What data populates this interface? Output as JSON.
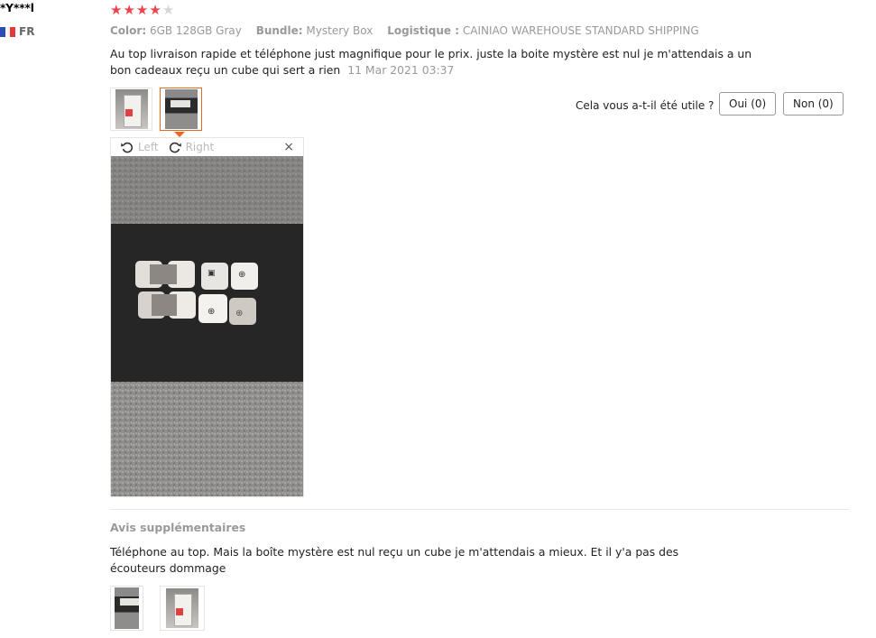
{
  "user": {
    "name": "*Y***l",
    "country": "FR"
  },
  "rating": {
    "value": 4,
    "max": 5
  },
  "specs": [
    {
      "label": "Color:",
      "value": "6GB 128GB Gray"
    },
    {
      "label": "Bundle:",
      "value": "Mystery Box"
    },
    {
      "label": "Logistique :",
      "value": "CAINIAO WAREHOUSE STANDARD SHIPPING"
    }
  ],
  "review": {
    "text": "Au top livraison rapide et téléphone just magnifique pour le prix. juste la boite mystère est nul je m'attendais a un bon cadeaux reçu un cube qui sert a rien",
    "date": "11 Mar 2021 03:37"
  },
  "helpful": {
    "question": "Cela vous a-t-il été utile ?",
    "yes_label": "Oui (0)",
    "no_label": "Non (0)"
  },
  "viewer": {
    "rotate_left": "Left",
    "rotate_right": "Right",
    "close": "×"
  },
  "additional": {
    "title": "Avis supplémentaires",
    "text": "Téléphone au top. Mais la boîte mystère est nul reçu un cube je m'attendais a mieux. Et il y'a pas des écouteurs dommage"
  },
  "colors": {
    "star": "#f0424b",
    "active_border": "#e56a1f"
  }
}
